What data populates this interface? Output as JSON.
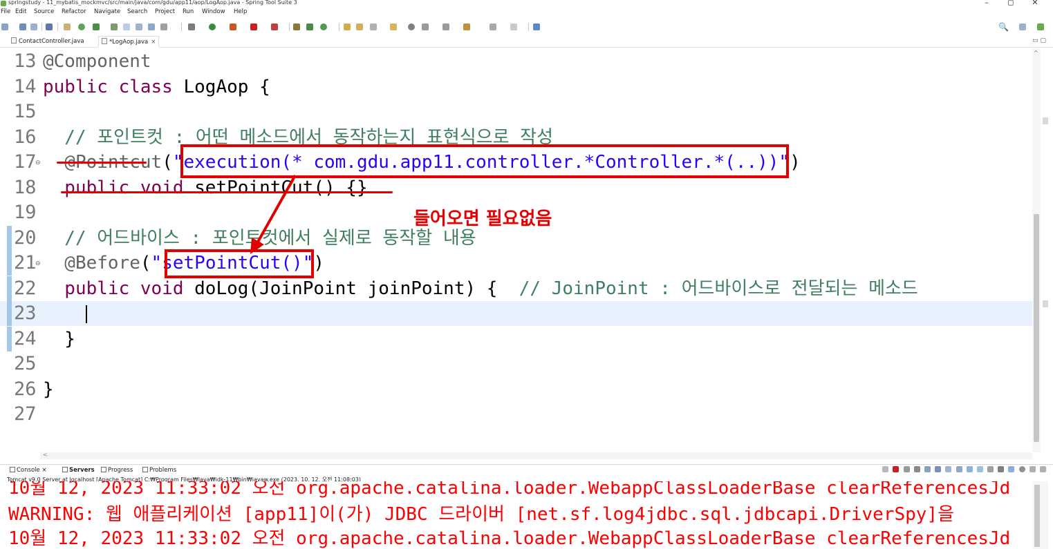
{
  "window": {
    "title": "springstudy - 11_mybatis_mockmvc/src/main/java/com/gdu/app11/aop/LogAop.java - Spring Tool Suite 3",
    "minimize": "–",
    "maximize": "◻",
    "close": "✕"
  },
  "menu": [
    "File",
    "Edit",
    "Source",
    "Refactor",
    "Navigate",
    "Search",
    "Project",
    "Run",
    "Window",
    "Help"
  ],
  "tabs": [
    {
      "label": "ContactController.java",
      "active": false
    },
    {
      "label": "*LogAop.java",
      "active": true,
      "close": "×"
    }
  ],
  "editor": {
    "lines": [
      {
        "num": "13",
        "code": [
          {
            "t": "@Component",
            "c": "ann"
          }
        ]
      },
      {
        "num": "14",
        "code": [
          {
            "t": "public class ",
            "c": "kw"
          },
          {
            "t": "LogAop {",
            "c": ""
          }
        ]
      },
      {
        "num": "15",
        "code": []
      },
      {
        "num": "16",
        "code": [
          {
            "t": "  // 포인트컷 : 어떤 메소드에서 동작하는지 표현식으로 작성",
            "c": "cmt"
          }
        ]
      },
      {
        "num": "17",
        "fold": "⊖",
        "code": [
          {
            "t": "  @Pointcut",
            "c": "ann"
          },
          {
            "t": "(",
            "c": ""
          },
          {
            "t": "\"execution(* com.gdu.app11.controller.*Controller.*(..))\"",
            "c": "str"
          },
          {
            "t": ")",
            "c": ""
          }
        ]
      },
      {
        "num": "18",
        "code": [
          {
            "t": "  public void ",
            "c": "kw"
          },
          {
            "t": "setPointCut() {}",
            "c": ""
          }
        ]
      },
      {
        "num": "19",
        "code": []
      },
      {
        "num": "20",
        "code": [
          {
            "t": "  // 어드바이스 : 포인트컷에서 실제로 동작할 내용",
            "c": "cmt"
          }
        ]
      },
      {
        "num": "21",
        "fold": "⊖",
        "code": [
          {
            "t": "  @Before",
            "c": "ann"
          },
          {
            "t": "(",
            "c": ""
          },
          {
            "t": "\"setPointCut()\"",
            "c": "str"
          },
          {
            "t": ")",
            "c": ""
          }
        ]
      },
      {
        "num": "22",
        "code": [
          {
            "t": "  public void ",
            "c": "kw"
          },
          {
            "t": "doLog(JoinPoint joinPoint) {  ",
            "c": ""
          },
          {
            "t": "// JoinPoint : 어드바이스로 전달되는 메소드",
            "c": "cmt"
          }
        ]
      },
      {
        "num": "23",
        "code": [],
        "current": true
      },
      {
        "num": "24",
        "code": [
          {
            "t": "  }",
            "c": ""
          }
        ]
      },
      {
        "num": "25",
        "code": []
      },
      {
        "num": "26",
        "code": [
          {
            "t": "}",
            "c": ""
          }
        ]
      },
      {
        "num": "27",
        "code": []
      }
    ]
  },
  "annotation": {
    "note": "들어오면 필요없음",
    "color": "#e00000"
  },
  "console": {
    "tabs": [
      {
        "label": "Console",
        "close": "×"
      },
      {
        "label": "Servers",
        "bold": true
      },
      {
        "label": "Progress"
      },
      {
        "label": "Problems"
      }
    ],
    "server": "Tomcat v9.0 Server at localhost [Apache Tomcat] C:₩Program Files₩Java₩jdk-11₩bin₩javaw.exe  (2023. 10. 12. 오전 11:08:03)",
    "lines": [
      "10월 12, 2023 11:33:02 오전 org.apache.catalina.loader.WebappClassLoaderBase clearReferencesJd",
      "WARNING: 웹 애플리케이션 [app11]이(가) JDBC 드라이버 [net.sf.log4jdbc.sql.jdbcapi.DriverSpy]을",
      "10월 12, 2023 11:33:02 오전 org.apache.catalina.loader.WebappClassLoaderBase clearReferencesJd"
    ]
  },
  "colors": {
    "keyword": "#7f0055",
    "annotation": "#646464",
    "string": "#2a00ff",
    "comment": "#3f7f5f",
    "console_error": "#ff0000",
    "current_line": "#e8f2fe"
  }
}
